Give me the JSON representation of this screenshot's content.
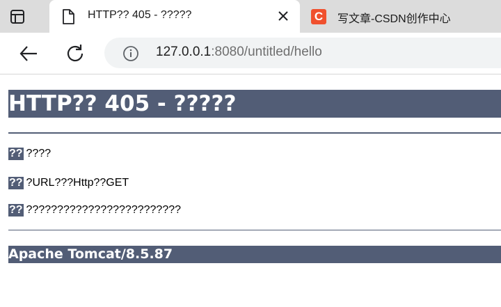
{
  "browser": {
    "tabs": [
      {
        "title": "HTTP?? 405 - ?????",
        "active": true,
        "icon": "document-icon"
      },
      {
        "title": "写文章-CSDN创作中心",
        "active": false,
        "icon": "csdn-logo",
        "logo_letter": "C"
      }
    ],
    "url": {
      "host": "127.0.0.1",
      "rest": ":8080/untitled/hello"
    }
  },
  "page": {
    "heading": "HTTP?? 405 - ?????",
    "rows": [
      {
        "label": "??",
        "value": "????"
      },
      {
        "label": "??",
        "value": "?URL???Http??GET"
      },
      {
        "label": "??",
        "value": "?????????????????????????"
      }
    ],
    "server_info": "Apache Tomcat/8.5.87"
  },
  "colors": {
    "tomcat_band": "#525d76",
    "tab_strip": "#dcdcdc",
    "csdn_brand": "#f0502e",
    "omnibox": "#f1f3f4"
  }
}
